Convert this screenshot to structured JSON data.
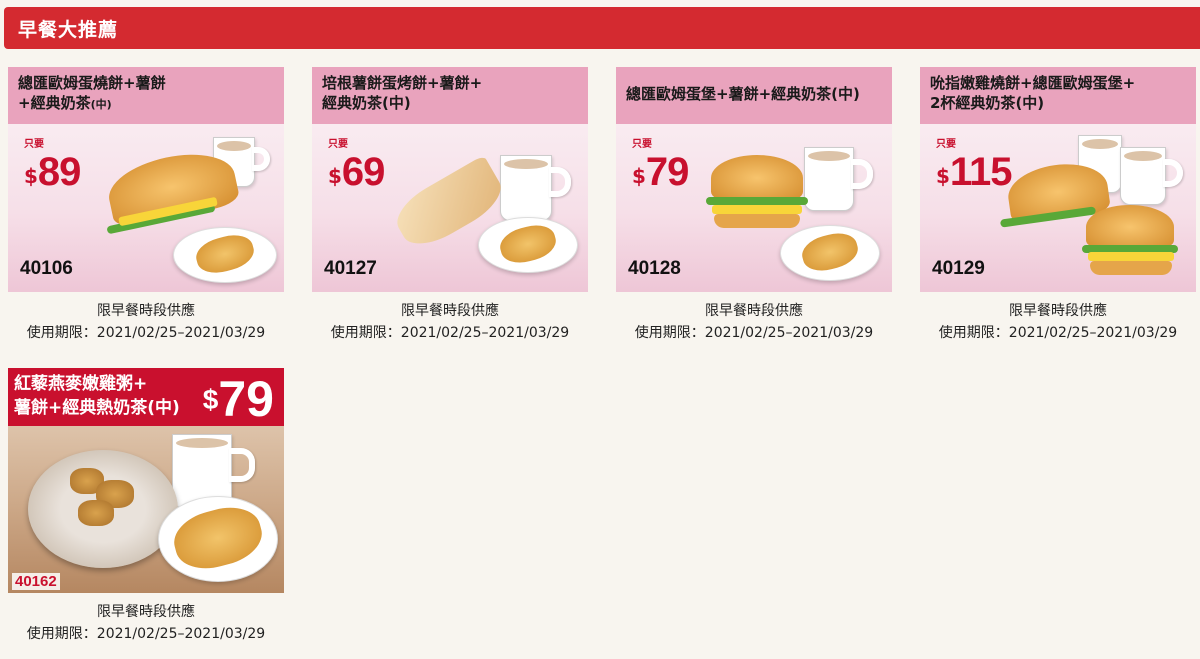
{
  "header": {
    "title": "早餐大推薦"
  },
  "coupons": [
    {
      "title_main": "總匯歐姆蛋燒餅+薯餅",
      "title_line2": "+經典奶茶",
      "title_small": "(中)",
      "price_only": "只要",
      "price_dollar": "$",
      "price": "89",
      "code": "40106",
      "caption_1": "限早餐時段供應",
      "caption_2": "使用期限：2021/02/25–2021/03/29"
    },
    {
      "title_main": "培根薯餅蛋烤餅+薯餅+",
      "title_line2": "經典奶茶(中)",
      "title_small": "",
      "price_only": "只要",
      "price_dollar": "$",
      "price": "69",
      "code": "40127",
      "caption_1": "限早餐時段供應",
      "caption_2": "使用期限：2021/02/25–2021/03/29"
    },
    {
      "title_main": "總匯歐姆蛋堡+薯餅+經典奶茶(中)",
      "title_line2": "",
      "title_small": "",
      "price_only": "只要",
      "price_dollar": "$",
      "price": "79",
      "code": "40128",
      "caption_1": "限早餐時段供應",
      "caption_2": "使用期限：2021/02/25–2021/03/29"
    },
    {
      "title_main": "吮指嫩雞燒餅+總匯歐姆蛋堡+",
      "title_line2": "2杯經典奶茶(中)",
      "title_small": "",
      "price_only": "只要",
      "price_dollar": "$",
      "price": "115",
      "code": "40129",
      "caption_1": "限早餐時段供應",
      "caption_2": "使用期限：2021/02/25–2021/03/29"
    }
  ],
  "porridge": {
    "title_line1": "紅藜燕麥嫩雞粥+",
    "title_line2": "薯餅+經典熱奶茶(中)",
    "price_dollar": "$",
    "price": "79",
    "code": "40162",
    "caption_1": "限早餐時段供應",
    "caption_2": "使用期限：2021/02/25–2021/03/29"
  },
  "colors": {
    "header_red": "#d42a30",
    "title_pink": "#e9a3bd",
    "price_red": "#c8102e"
  }
}
